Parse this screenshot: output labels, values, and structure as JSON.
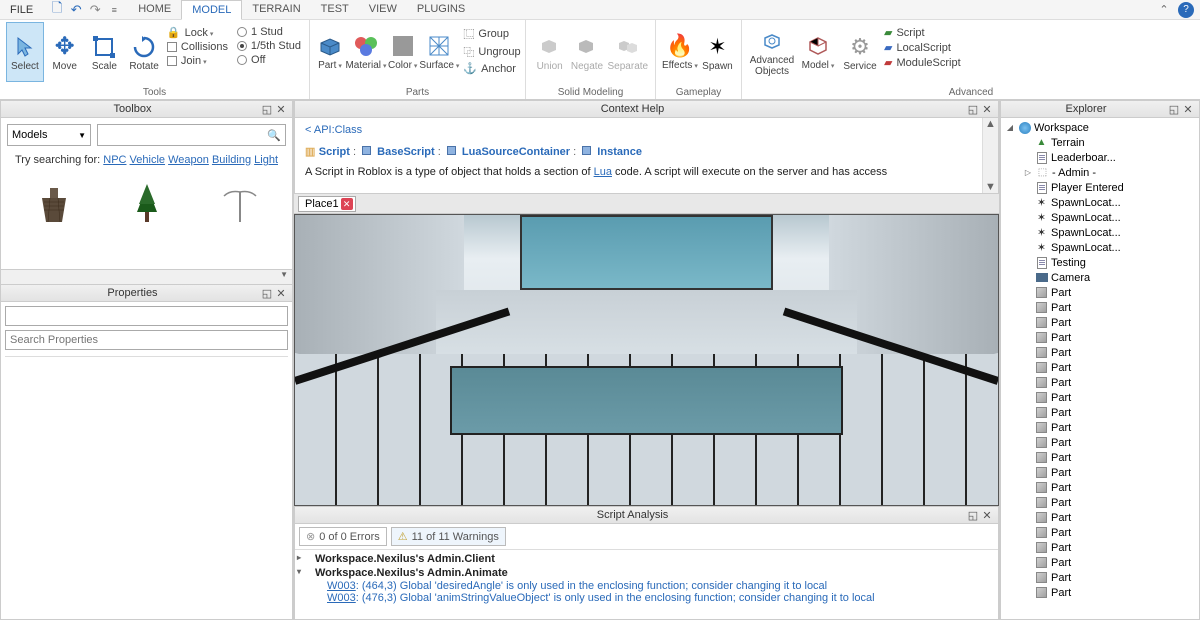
{
  "menubar": {
    "file": "FILE"
  },
  "tabs": [
    "HOME",
    "MODEL",
    "TERRAIN",
    "TEST",
    "VIEW",
    "PLUGINS"
  ],
  "active_tab": 1,
  "ribbon": {
    "tools": {
      "label": "Tools",
      "select": "Select",
      "move": "Move",
      "scale": "Scale",
      "rotate": "Rotate",
      "lock": "Lock",
      "collisions": "Collisions",
      "join": "Join",
      "stud1": "1 Stud",
      "stud5": "1/5th Stud",
      "off": "Off"
    },
    "parts": {
      "label": "Parts",
      "part": "Part",
      "material": "Material",
      "color": "Color",
      "surface": "Surface",
      "group": "Group",
      "ungroup": "Ungroup",
      "anchor": "Anchor"
    },
    "solid": {
      "label": "Solid Modeling",
      "union": "Union",
      "negate": "Negate",
      "separate": "Separate"
    },
    "gameplay": {
      "label": "Gameplay",
      "effects": "Effects",
      "spawn": "Spawn"
    },
    "advanced": {
      "label": "Advanced",
      "advobj": "Advanced Objects",
      "model": "Model",
      "service": "Service",
      "script": "Script",
      "localscript": "LocalScript",
      "modulescript": "ModuleScript"
    }
  },
  "toolbox": {
    "title": "Toolbox",
    "dropdown": "Models",
    "suggest_prefix": "Try searching for:",
    "suggest_links": [
      "NPC",
      "Vehicle",
      "Weapon",
      "Building",
      "Light"
    ]
  },
  "properties": {
    "title": "Properties",
    "search_ph": "Search Properties"
  },
  "context": {
    "title": "Context Help",
    "back": "< API:Class",
    "chain": [
      "Script",
      "BaseScript",
      "LuaSourceContainer",
      "Instance"
    ],
    "desc_pre": "A Script in Roblox is a type of object that holds a section of ",
    "desc_link": "Lua",
    "desc_post": " code. A script will execute on the server and has access"
  },
  "place_tab": "Place1",
  "script_analysis": {
    "title": "Script Analysis",
    "errors": "0 of 0 Errors",
    "warnings": "11 of 11 Warnings",
    "items": [
      {
        "kind": "header",
        "text": "Workspace.Nexilus's Admin.Client",
        "expanded": false
      },
      {
        "kind": "header",
        "text": "Workspace.Nexilus's Admin.Animate",
        "expanded": true
      },
      {
        "kind": "warn",
        "code": "W003",
        "text": ": (464,3) Global 'desiredAngle' is only used in the enclosing function; consider changing it to local"
      },
      {
        "kind": "warn",
        "code": "W003",
        "text": ": (476,3) Global 'animStringValueObject' is only used in the enclosing function; consider changing it to local"
      }
    ]
  },
  "explorer": {
    "title": "Explorer",
    "root": "Workspace",
    "items": [
      {
        "icon": "terrain",
        "label": "Terrain"
      },
      {
        "icon": "script",
        "label": "Leaderboar..."
      },
      {
        "icon": "model",
        "label": "- Admin -",
        "expandable": true
      },
      {
        "icon": "script",
        "label": "Player Entered"
      },
      {
        "icon": "spawn",
        "label": "SpawnLocat..."
      },
      {
        "icon": "spawn",
        "label": "SpawnLocat..."
      },
      {
        "icon": "spawn",
        "label": "SpawnLocat..."
      },
      {
        "icon": "spawn",
        "label": "SpawnLocat..."
      },
      {
        "icon": "script",
        "label": "Testing"
      },
      {
        "icon": "camera",
        "label": "Camera"
      },
      {
        "icon": "part",
        "label": "Part"
      },
      {
        "icon": "part",
        "label": "Part"
      },
      {
        "icon": "part",
        "label": "Part"
      },
      {
        "icon": "part",
        "label": "Part"
      },
      {
        "icon": "part",
        "label": "Part"
      },
      {
        "icon": "part",
        "label": "Part"
      },
      {
        "icon": "part",
        "label": "Part"
      },
      {
        "icon": "part",
        "label": "Part"
      },
      {
        "icon": "part",
        "label": "Part"
      },
      {
        "icon": "part",
        "label": "Part"
      },
      {
        "icon": "part",
        "label": "Part"
      },
      {
        "icon": "part",
        "label": "Part"
      },
      {
        "icon": "part",
        "label": "Part"
      },
      {
        "icon": "part",
        "label": "Part"
      },
      {
        "icon": "part",
        "label": "Part"
      },
      {
        "icon": "part",
        "label": "Part"
      },
      {
        "icon": "part",
        "label": "Part"
      },
      {
        "icon": "part",
        "label": "Part"
      },
      {
        "icon": "part",
        "label": "Part"
      },
      {
        "icon": "part",
        "label": "Part"
      },
      {
        "icon": "part",
        "label": "Part"
      }
    ]
  }
}
